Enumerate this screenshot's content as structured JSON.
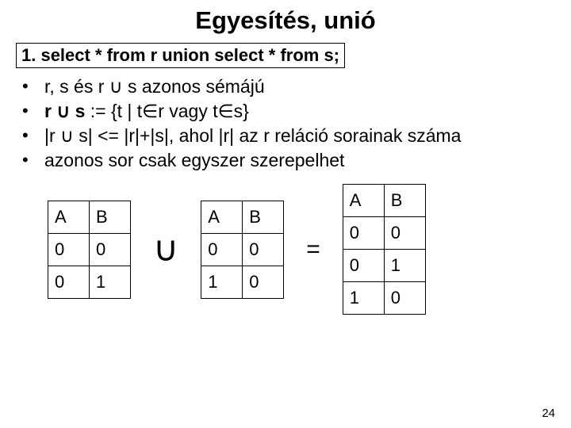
{
  "title": "Egyesítés, unió",
  "boxed": "1. select * from r union select * from s;",
  "bullets": [
    "r, s és r ∪ s azonos sémájú",
    "",
    "|r ∪ s| <= |r|+|s|, ahol |r| az r reláció sorainak száma",
    "azonos sor csak egyszer szerepelhet"
  ],
  "bullet2_prefix": "r ∪ s",
  "bullet2_rest": " := {t | t∈r vagy t∈s}",
  "op_union": "∪",
  "op_eq": "=",
  "tables": {
    "left": {
      "headers": [
        "A",
        "B"
      ],
      "rows": [
        [
          "0",
          "0"
        ],
        [
          "0",
          "1"
        ]
      ]
    },
    "mid": {
      "headers": [
        "A",
        "B"
      ],
      "rows": [
        [
          "0",
          "0"
        ],
        [
          "1",
          "0"
        ]
      ]
    },
    "right": {
      "headers": [
        "A",
        "B"
      ],
      "rows": [
        [
          "0",
          "0"
        ],
        [
          "0",
          "1"
        ],
        [
          "1",
          "0"
        ]
      ]
    }
  },
  "page_number": "24"
}
